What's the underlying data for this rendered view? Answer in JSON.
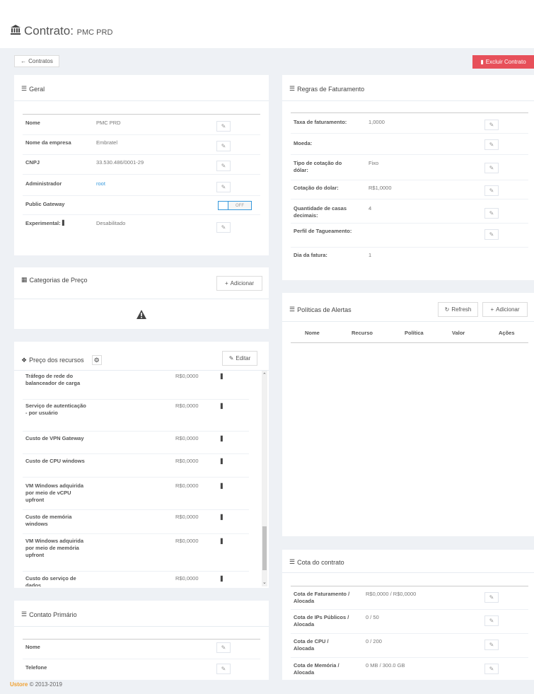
{
  "page": {
    "title": "Contrato:",
    "subtitle": "PMC PRD"
  },
  "toolbar": {
    "back_label": "Contratos",
    "delete_label": "Excluir Contrato"
  },
  "geral": {
    "title": "Geral",
    "rows": [
      {
        "label": "Nome",
        "value": "PMC PRD"
      },
      {
        "label": "Nome da empresa",
        "value": "Embratel"
      },
      {
        "label": "CNPJ",
        "value": "33.530.486/0001-29"
      },
      {
        "label": "Administrador",
        "value": "root"
      },
      {
        "label": "Public Gateway",
        "value": "OFF"
      },
      {
        "label": "Experimental:",
        "value": "Desabilitado"
      }
    ]
  },
  "categorias": {
    "title": "Categorias de Preço",
    "add_label": "Adicionar"
  },
  "precos": {
    "title": "Preço dos recursos",
    "edit_label": "Editar",
    "rows": [
      {
        "label": "Tráfego de rede do balanceador de carga",
        "value": "R$0,0000"
      },
      {
        "label": "Serviço de autenticação - por usuário",
        "value": "R$0,0000"
      },
      {
        "label": "Custo de VPN Gateway",
        "value": "R$0,0000"
      },
      {
        "label": "Custo de CPU windows",
        "value": "R$0,0000"
      },
      {
        "label": "VM Windows adquirida por meio de vCPU upfront",
        "value": "R$0,0000"
      },
      {
        "label": "Custo de memória windows",
        "value": "R$0,0000"
      },
      {
        "label": "VM Windows adquirida por meio de memória upfront",
        "value": "R$0,0000"
      },
      {
        "label": "Custo do serviço de dados",
        "value": "R$0,0000"
      }
    ]
  },
  "contato": {
    "title": "Contato Primário",
    "rows": [
      {
        "label": "Nome"
      },
      {
        "label": "Telefone"
      }
    ]
  },
  "regras": {
    "title": "Regras de Faturamento",
    "rows": [
      {
        "label": "Taxa de faturamento:",
        "value": "1,0000"
      },
      {
        "label": "Moeda:",
        "value": ""
      },
      {
        "label": "Tipo de cotação do dólar:",
        "value": "Fixo"
      },
      {
        "label": "Cotação do dolar:",
        "value": "R$1,0000"
      },
      {
        "label": "Quantidade de casas decimais:",
        "value": "4"
      },
      {
        "label": "Perfil de Tagueamento:",
        "value": ""
      },
      {
        "label": "Dia da fatura:",
        "value": "1"
      }
    ]
  },
  "alertas": {
    "title": "Políticas de Alertas",
    "refresh_label": "Refresh",
    "add_label": "Adicionar",
    "columns": [
      "Nome",
      "Recurso",
      "Política",
      "Valor",
      "Ações"
    ]
  },
  "cota": {
    "title": "Cota do contrato",
    "rows": [
      {
        "label": "Cota de Faturamento / Alocada",
        "value": "R$0,0000 / R$0,0000"
      },
      {
        "label": "Cota de IPs Públicos / Alocada",
        "value": "0 / 50"
      },
      {
        "label": "Cota de CPU / Alocada",
        "value": "0 / 200"
      },
      {
        "label": "Cota de Memória / Alocada",
        "value": "0 MB / 300.0 GB"
      }
    ]
  },
  "footer": {
    "brand": "Ustore",
    "copyright": "© 2013-2019"
  }
}
